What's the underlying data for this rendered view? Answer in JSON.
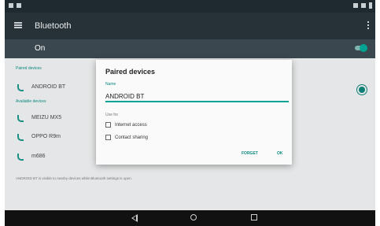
{
  "appbar": {
    "title": "Bluetooth"
  },
  "switchbar": {
    "label": "On"
  },
  "paired_devices": {
    "header": "Paired devices",
    "items": [
      {
        "name": "ANDROID BT"
      }
    ]
  },
  "available_devices": {
    "header": "Available devices",
    "items": [
      {
        "name": "MEIZU MX5"
      },
      {
        "name": "OPPO R9m"
      },
      {
        "name": "m686"
      }
    ]
  },
  "info_text": "ANDROID BT is visible to nearby devices while Bluetooth settings is open.",
  "dialog": {
    "title": "Paired devices",
    "name_label": "Name",
    "name_value": "ANDROID BT",
    "use_for_label": "Use for",
    "options": [
      {
        "label": "Internet access",
        "checked": false
      },
      {
        "label": "Contact sharing",
        "checked": false
      }
    ],
    "forget_label": "FORGET",
    "ok_label": "OK"
  },
  "colors": {
    "accent": "#00a393",
    "appbar": "#263238",
    "switchbar": "#3a474e"
  }
}
